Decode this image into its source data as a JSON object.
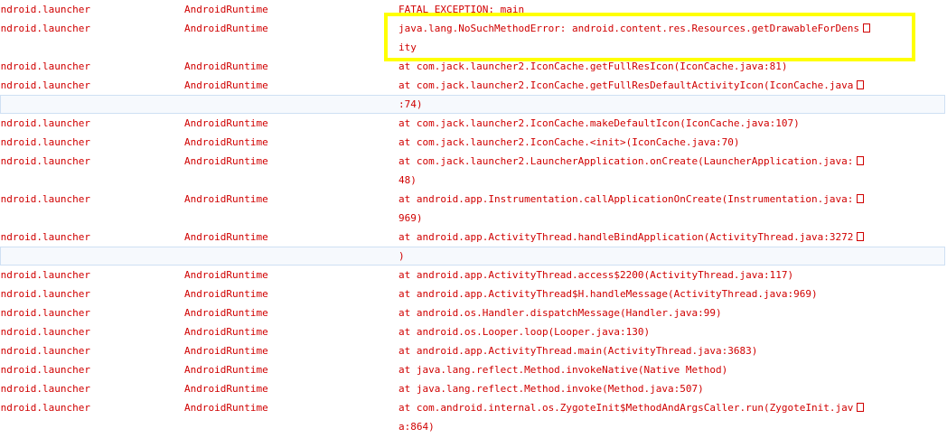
{
  "log": {
    "rows": [
      {
        "pid": "android.launcher",
        "tag": "AndroidRuntime",
        "message": "FATAL EXCEPTION: main",
        "wrap": false,
        "selected": false
      },
      {
        "pid": "android.launcher",
        "tag": "AndroidRuntime",
        "message": "java.lang.NoSuchMethodError: android.content.res.Resources.getDrawableForDens",
        "wrap": true,
        "selected": false
      },
      {
        "pid": "",
        "tag": "",
        "message": "ity",
        "wrap": false,
        "selected": false
      },
      {
        "pid": "android.launcher",
        "tag": "AndroidRuntime",
        "message": "at com.jack.launcher2.IconCache.getFullResIcon(IconCache.java:81)",
        "wrap": false,
        "selected": false
      },
      {
        "pid": "android.launcher",
        "tag": "AndroidRuntime",
        "message": "at com.jack.launcher2.IconCache.getFullResDefaultActivityIcon(IconCache.java",
        "wrap": true,
        "selected": false
      },
      {
        "pid": "",
        "tag": "",
        "message": ":74)",
        "wrap": false,
        "selected": true
      },
      {
        "pid": "android.launcher",
        "tag": "AndroidRuntime",
        "message": "at com.jack.launcher2.IconCache.makeDefaultIcon(IconCache.java:107)",
        "wrap": false,
        "selected": false
      },
      {
        "pid": "android.launcher",
        "tag": "AndroidRuntime",
        "message": "at com.jack.launcher2.IconCache.<init>(IconCache.java:70)",
        "wrap": false,
        "selected": false
      },
      {
        "pid": "android.launcher",
        "tag": "AndroidRuntime",
        "message": "at com.jack.launcher2.LauncherApplication.onCreate(LauncherApplication.java:",
        "wrap": true,
        "selected": false
      },
      {
        "pid": "",
        "tag": "",
        "message": "48)",
        "wrap": false,
        "selected": false
      },
      {
        "pid": "android.launcher",
        "tag": "AndroidRuntime",
        "message": "at android.app.Instrumentation.callApplicationOnCreate(Instrumentation.java:",
        "wrap": true,
        "selected": false
      },
      {
        "pid": "",
        "tag": "",
        "message": "969)",
        "wrap": false,
        "selected": false
      },
      {
        "pid": "android.launcher",
        "tag": "AndroidRuntime",
        "message": "at android.app.ActivityThread.handleBindApplication(ActivityThread.java:3272",
        "wrap": true,
        "selected": false
      },
      {
        "pid": "",
        "tag": "",
        "message": ")",
        "wrap": false,
        "selected": true
      },
      {
        "pid": "android.launcher",
        "tag": "AndroidRuntime",
        "message": "at android.app.ActivityThread.access$2200(ActivityThread.java:117)",
        "wrap": false,
        "selected": false
      },
      {
        "pid": "android.launcher",
        "tag": "AndroidRuntime",
        "message": "at android.app.ActivityThread$H.handleMessage(ActivityThread.java:969)",
        "wrap": false,
        "selected": false
      },
      {
        "pid": "android.launcher",
        "tag": "AndroidRuntime",
        "message": "at android.os.Handler.dispatchMessage(Handler.java:99)",
        "wrap": false,
        "selected": false
      },
      {
        "pid": "android.launcher",
        "tag": "AndroidRuntime",
        "message": "at android.os.Looper.loop(Looper.java:130)",
        "wrap": false,
        "selected": false
      },
      {
        "pid": "android.launcher",
        "tag": "AndroidRuntime",
        "message": "at android.app.ActivityThread.main(ActivityThread.java:3683)",
        "wrap": false,
        "selected": false
      },
      {
        "pid": "android.launcher",
        "tag": "AndroidRuntime",
        "message": "at java.lang.reflect.Method.invokeNative(Native Method)",
        "wrap": false,
        "selected": false
      },
      {
        "pid": "android.launcher",
        "tag": "AndroidRuntime",
        "message": "at java.lang.reflect.Method.invoke(Method.java:507)",
        "wrap": false,
        "selected": false
      },
      {
        "pid": "android.launcher",
        "tag": "AndroidRuntime",
        "message": "at com.android.internal.os.ZygoteInit$MethodAndArgsCaller.run(ZygoteInit.jav",
        "wrap": true,
        "selected": false
      },
      {
        "pid": "",
        "tag": "",
        "message": "a:864)",
        "wrap": false,
        "selected": false
      }
    ]
  },
  "colors": {
    "error_text": "#d00000",
    "highlight_box": "#ffff00",
    "selected_row_border": "#cfe0f3"
  },
  "icons": {
    "wrap": "line-wrap-icon"
  }
}
